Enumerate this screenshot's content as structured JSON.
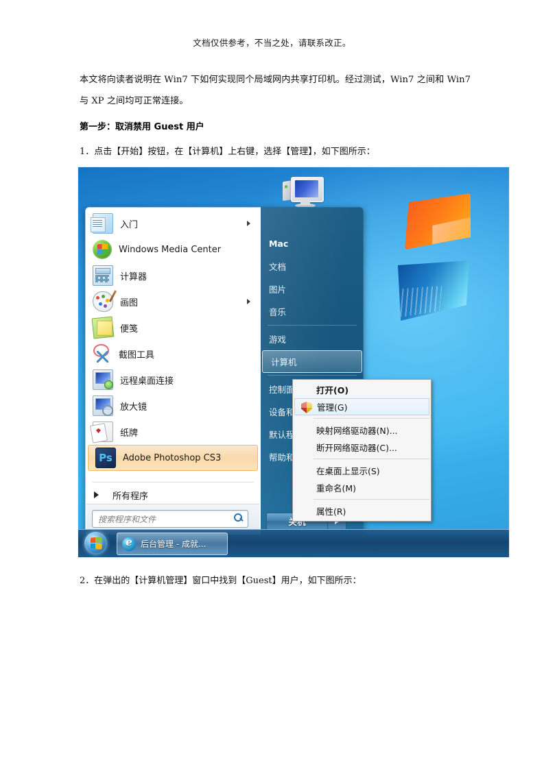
{
  "document": {
    "header_note": "文档仅供参考，不当之处，请联系改正。",
    "intro_paragraph": "本文将向读者说明在 Win7 下如何实现同个局域网内共享打印机。经过测试，Win7 之间和 Win7 与 XP 之间均可正常连接。",
    "step_heading": "第一步：取消禁用 Guest 用户",
    "step_1": "1．点击【开始】按钮，在【计算机】上右键，选择【管理】，如下图所示：",
    "step_2": "2．在弹出的【计算机管理】窗口中找到【Guest】用户，如下图所示："
  },
  "screenshot": {
    "start_menu": {
      "user_picture_icon": "computer-monitor-icon",
      "programs": [
        {
          "label": "入门",
          "icon": "getting-started-icon",
          "has_submenu": true,
          "selected": false
        },
        {
          "label": "Windows Media Center",
          "icon": "windows-media-center-icon",
          "has_submenu": false,
          "selected": false
        },
        {
          "label": "计算器",
          "icon": "calculator-icon",
          "has_submenu": false,
          "selected": false
        },
        {
          "label": "画图",
          "icon": "paint-icon",
          "has_submenu": true,
          "selected": false
        },
        {
          "label": "便笺",
          "icon": "sticky-notes-icon",
          "has_submenu": false,
          "selected": false
        },
        {
          "label": "截图工具",
          "icon": "snipping-tool-icon",
          "has_submenu": false,
          "selected": false
        },
        {
          "label": "远程桌面连接",
          "icon": "remote-desktop-icon",
          "has_submenu": false,
          "selected": false
        },
        {
          "label": "放大镜",
          "icon": "magnifier-icon",
          "has_submenu": false,
          "selected": false
        },
        {
          "label": "纸牌",
          "icon": "solitaire-cards-icon",
          "has_submenu": false,
          "selected": false
        },
        {
          "label": "Adobe Photoshop CS3",
          "icon": "photoshop-icon",
          "has_submenu": false,
          "selected": true
        }
      ],
      "photoshop_icon_text": "Ps",
      "all_programs_label": "所有程序",
      "search_placeholder": "搜索程序和文件",
      "search_value": "",
      "search_icon": "magnifier-icon",
      "right_items": [
        {
          "label": "Mac",
          "bold": true,
          "selected": false,
          "sep_after": false
        },
        {
          "label": "文档",
          "bold": false,
          "selected": false,
          "sep_after": false
        },
        {
          "label": "图片",
          "bold": false,
          "selected": false,
          "sep_after": false
        },
        {
          "label": "音乐",
          "bold": false,
          "selected": false,
          "sep_after": true
        },
        {
          "label": "游戏",
          "bold": false,
          "selected": false,
          "sep_after": false
        },
        {
          "label": "计算机",
          "bold": false,
          "selected": true,
          "sep_after": true
        },
        {
          "label": "控制面板",
          "bold": false,
          "selected": false,
          "sep_after": false
        },
        {
          "label": "设备和打印机",
          "bold": false,
          "selected": false,
          "sep_after": false
        },
        {
          "label": "默认程序",
          "bold": false,
          "selected": false,
          "sep_after": false
        },
        {
          "label": "帮助和支持",
          "bold": false,
          "selected": false,
          "sep_after": false
        }
      ],
      "shutdown_label": "关机",
      "shutdown_arrow_icon": "chevron-right-icon"
    },
    "context_menu": {
      "items": [
        {
          "label": "打开(O)",
          "bold": true,
          "highlighted": false,
          "icon": null,
          "sep_after": false
        },
        {
          "label": "管理(G)",
          "bold": false,
          "highlighted": true,
          "icon": "shield-icon",
          "sep_after": true
        },
        {
          "label": "映射网络驱动器(N)...",
          "bold": false,
          "highlighted": false,
          "icon": null,
          "sep_after": false
        },
        {
          "label": "断开网络驱动器(C)...",
          "bold": false,
          "highlighted": false,
          "icon": null,
          "sep_after": true
        },
        {
          "label": "在桌面上显示(S)",
          "bold": false,
          "highlighted": false,
          "icon": null,
          "sep_after": false
        },
        {
          "label": "重命名(M)",
          "bold": false,
          "highlighted": false,
          "icon": null,
          "sep_after": true
        },
        {
          "label": "属性(R)",
          "bold": false,
          "highlighted": false,
          "icon": null,
          "sep_after": false
        }
      ]
    },
    "taskbar": {
      "start_orb_icon": "windows-start-orb-icon",
      "window_button_label": "后台管理 - 成就...",
      "window_button_icon": "internet-explorer-icon"
    },
    "wallpaper": {
      "logo_icon": "windows-7-logo",
      "accent_blue": "#2b94dd",
      "flag_orange": "#f4581c",
      "flag_blue": "#0c4f9e"
    }
  }
}
